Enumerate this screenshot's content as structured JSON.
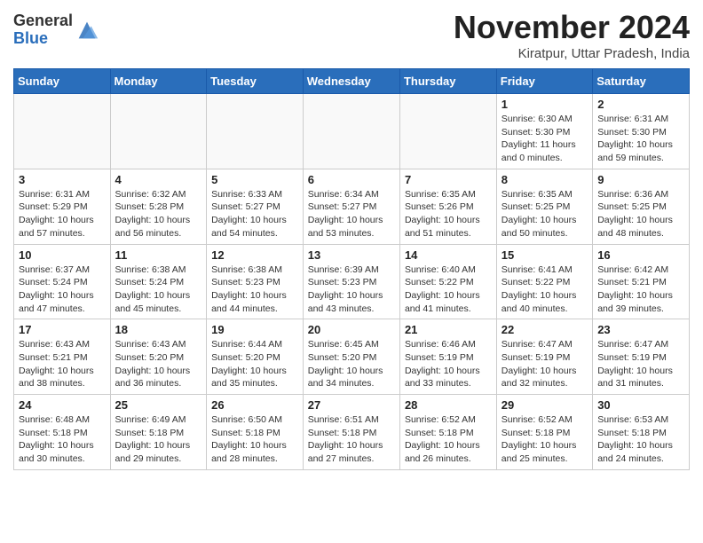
{
  "header": {
    "logo_general": "General",
    "logo_blue": "Blue",
    "title": "November 2024",
    "location": "Kiratpur, Uttar Pradesh, India"
  },
  "weekdays": [
    "Sunday",
    "Monday",
    "Tuesday",
    "Wednesday",
    "Thursday",
    "Friday",
    "Saturday"
  ],
  "weeks": [
    [
      {
        "day": "",
        "info": ""
      },
      {
        "day": "",
        "info": ""
      },
      {
        "day": "",
        "info": ""
      },
      {
        "day": "",
        "info": ""
      },
      {
        "day": "",
        "info": ""
      },
      {
        "day": "1",
        "info": "Sunrise: 6:30 AM\nSunset: 5:30 PM\nDaylight: 11 hours and 0 minutes."
      },
      {
        "day": "2",
        "info": "Sunrise: 6:31 AM\nSunset: 5:30 PM\nDaylight: 10 hours and 59 minutes."
      }
    ],
    [
      {
        "day": "3",
        "info": "Sunrise: 6:31 AM\nSunset: 5:29 PM\nDaylight: 10 hours and 57 minutes."
      },
      {
        "day": "4",
        "info": "Sunrise: 6:32 AM\nSunset: 5:28 PM\nDaylight: 10 hours and 56 minutes."
      },
      {
        "day": "5",
        "info": "Sunrise: 6:33 AM\nSunset: 5:27 PM\nDaylight: 10 hours and 54 minutes."
      },
      {
        "day": "6",
        "info": "Sunrise: 6:34 AM\nSunset: 5:27 PM\nDaylight: 10 hours and 53 minutes."
      },
      {
        "day": "7",
        "info": "Sunrise: 6:35 AM\nSunset: 5:26 PM\nDaylight: 10 hours and 51 minutes."
      },
      {
        "day": "8",
        "info": "Sunrise: 6:35 AM\nSunset: 5:25 PM\nDaylight: 10 hours and 50 minutes."
      },
      {
        "day": "9",
        "info": "Sunrise: 6:36 AM\nSunset: 5:25 PM\nDaylight: 10 hours and 48 minutes."
      }
    ],
    [
      {
        "day": "10",
        "info": "Sunrise: 6:37 AM\nSunset: 5:24 PM\nDaylight: 10 hours and 47 minutes."
      },
      {
        "day": "11",
        "info": "Sunrise: 6:38 AM\nSunset: 5:24 PM\nDaylight: 10 hours and 45 minutes."
      },
      {
        "day": "12",
        "info": "Sunrise: 6:38 AM\nSunset: 5:23 PM\nDaylight: 10 hours and 44 minutes."
      },
      {
        "day": "13",
        "info": "Sunrise: 6:39 AM\nSunset: 5:23 PM\nDaylight: 10 hours and 43 minutes."
      },
      {
        "day": "14",
        "info": "Sunrise: 6:40 AM\nSunset: 5:22 PM\nDaylight: 10 hours and 41 minutes."
      },
      {
        "day": "15",
        "info": "Sunrise: 6:41 AM\nSunset: 5:22 PM\nDaylight: 10 hours and 40 minutes."
      },
      {
        "day": "16",
        "info": "Sunrise: 6:42 AM\nSunset: 5:21 PM\nDaylight: 10 hours and 39 minutes."
      }
    ],
    [
      {
        "day": "17",
        "info": "Sunrise: 6:43 AM\nSunset: 5:21 PM\nDaylight: 10 hours and 38 minutes."
      },
      {
        "day": "18",
        "info": "Sunrise: 6:43 AM\nSunset: 5:20 PM\nDaylight: 10 hours and 36 minutes."
      },
      {
        "day": "19",
        "info": "Sunrise: 6:44 AM\nSunset: 5:20 PM\nDaylight: 10 hours and 35 minutes."
      },
      {
        "day": "20",
        "info": "Sunrise: 6:45 AM\nSunset: 5:20 PM\nDaylight: 10 hours and 34 minutes."
      },
      {
        "day": "21",
        "info": "Sunrise: 6:46 AM\nSunset: 5:19 PM\nDaylight: 10 hours and 33 minutes."
      },
      {
        "day": "22",
        "info": "Sunrise: 6:47 AM\nSunset: 5:19 PM\nDaylight: 10 hours and 32 minutes."
      },
      {
        "day": "23",
        "info": "Sunrise: 6:47 AM\nSunset: 5:19 PM\nDaylight: 10 hours and 31 minutes."
      }
    ],
    [
      {
        "day": "24",
        "info": "Sunrise: 6:48 AM\nSunset: 5:18 PM\nDaylight: 10 hours and 30 minutes."
      },
      {
        "day": "25",
        "info": "Sunrise: 6:49 AM\nSunset: 5:18 PM\nDaylight: 10 hours and 29 minutes."
      },
      {
        "day": "26",
        "info": "Sunrise: 6:50 AM\nSunset: 5:18 PM\nDaylight: 10 hours and 28 minutes."
      },
      {
        "day": "27",
        "info": "Sunrise: 6:51 AM\nSunset: 5:18 PM\nDaylight: 10 hours and 27 minutes."
      },
      {
        "day": "28",
        "info": "Sunrise: 6:52 AM\nSunset: 5:18 PM\nDaylight: 10 hours and 26 minutes."
      },
      {
        "day": "29",
        "info": "Sunrise: 6:52 AM\nSunset: 5:18 PM\nDaylight: 10 hours and 25 minutes."
      },
      {
        "day": "30",
        "info": "Sunrise: 6:53 AM\nSunset: 5:18 PM\nDaylight: 10 hours and 24 minutes."
      }
    ]
  ]
}
